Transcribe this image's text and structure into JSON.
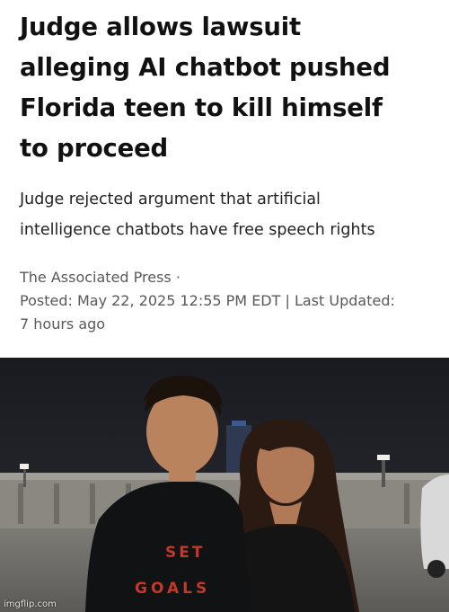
{
  "article": {
    "headline_lines": [
      "Judge allows lawsuit",
      "alleging AI chatbot pushed",
      "Florida teen to kill himself",
      "to proceed"
    ],
    "deck_lines": [
      "Judge rejected argument that artificial",
      "intelligence chatbots have free speech rights"
    ],
    "byline": "The Associated Press ·",
    "posted_line": "Posted: May 22, 2025 12:55 PM EDT | Last Updated:",
    "updated_line": "7 hours ago"
  },
  "photo": {
    "shirt_text_top": "SET",
    "shirt_text_bottom": "GOALS",
    "watermark": "imgflip.com"
  }
}
